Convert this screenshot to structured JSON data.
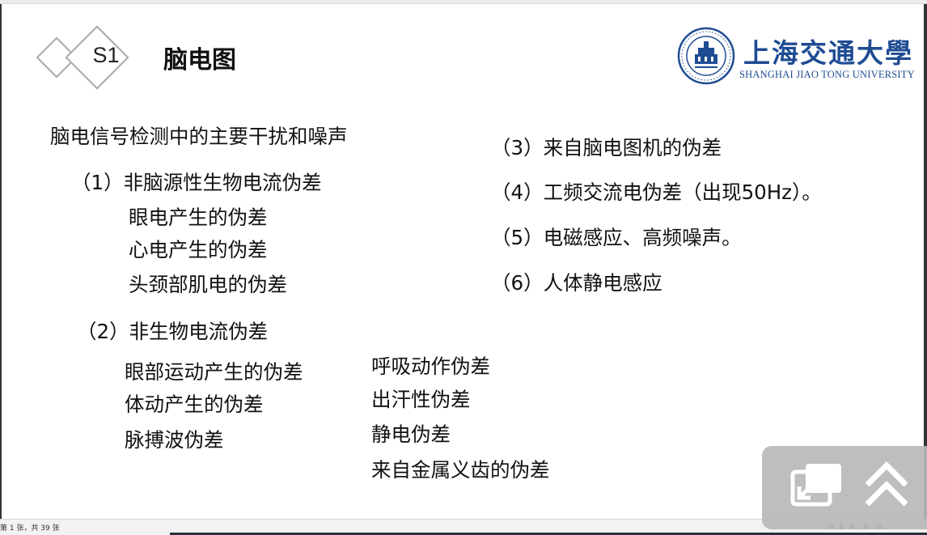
{
  "slide": {
    "section_code": "S1",
    "section_title": "脑电图",
    "logo": {
      "cn_name": "上海交通大學",
      "en_name": "SHANGHAI JIAO TONG UNIVERSITY"
    },
    "heading": "脑电信号检测中的主要干扰和噪声",
    "left_items": [
      "（1）非脑源性生物电流伪差",
      "眼电产生的伪差",
      "心电产生的伪差",
      "头颈部肌电的伪差",
      "（2）非生物电流伪差",
      "眼部运动产生的伪差",
      "体动产生的伪差",
      "脉搏波伪差"
    ],
    "middle_items": [
      "呼吸动作伪差",
      "出汗性伪差",
      "静电伪差",
      "来自金属义齿的伪差"
    ],
    "right_items": [
      "（3）来自脑电图机的伪差",
      "（4）工频交流电伪差（出现50Hz）。",
      "（5）电磁感应、高频噪声。",
      "（6）人体静电感应"
    ]
  },
  "status_bar": {
    "slide_counter": "第 1 张，共 39 张",
    "icons": [
      "prev-slide-icon",
      "reading-view-icon",
      "next-slide-icon",
      "normal-view-icon",
      "slide-sorter-icon"
    ]
  },
  "overlay": {
    "icons": [
      "restore-window-icon",
      "collapse-up-icon"
    ]
  },
  "colors": {
    "logo_blue": "#1f4c93",
    "diamond_gray": "#a9a9a9",
    "text": "#111111"
  }
}
